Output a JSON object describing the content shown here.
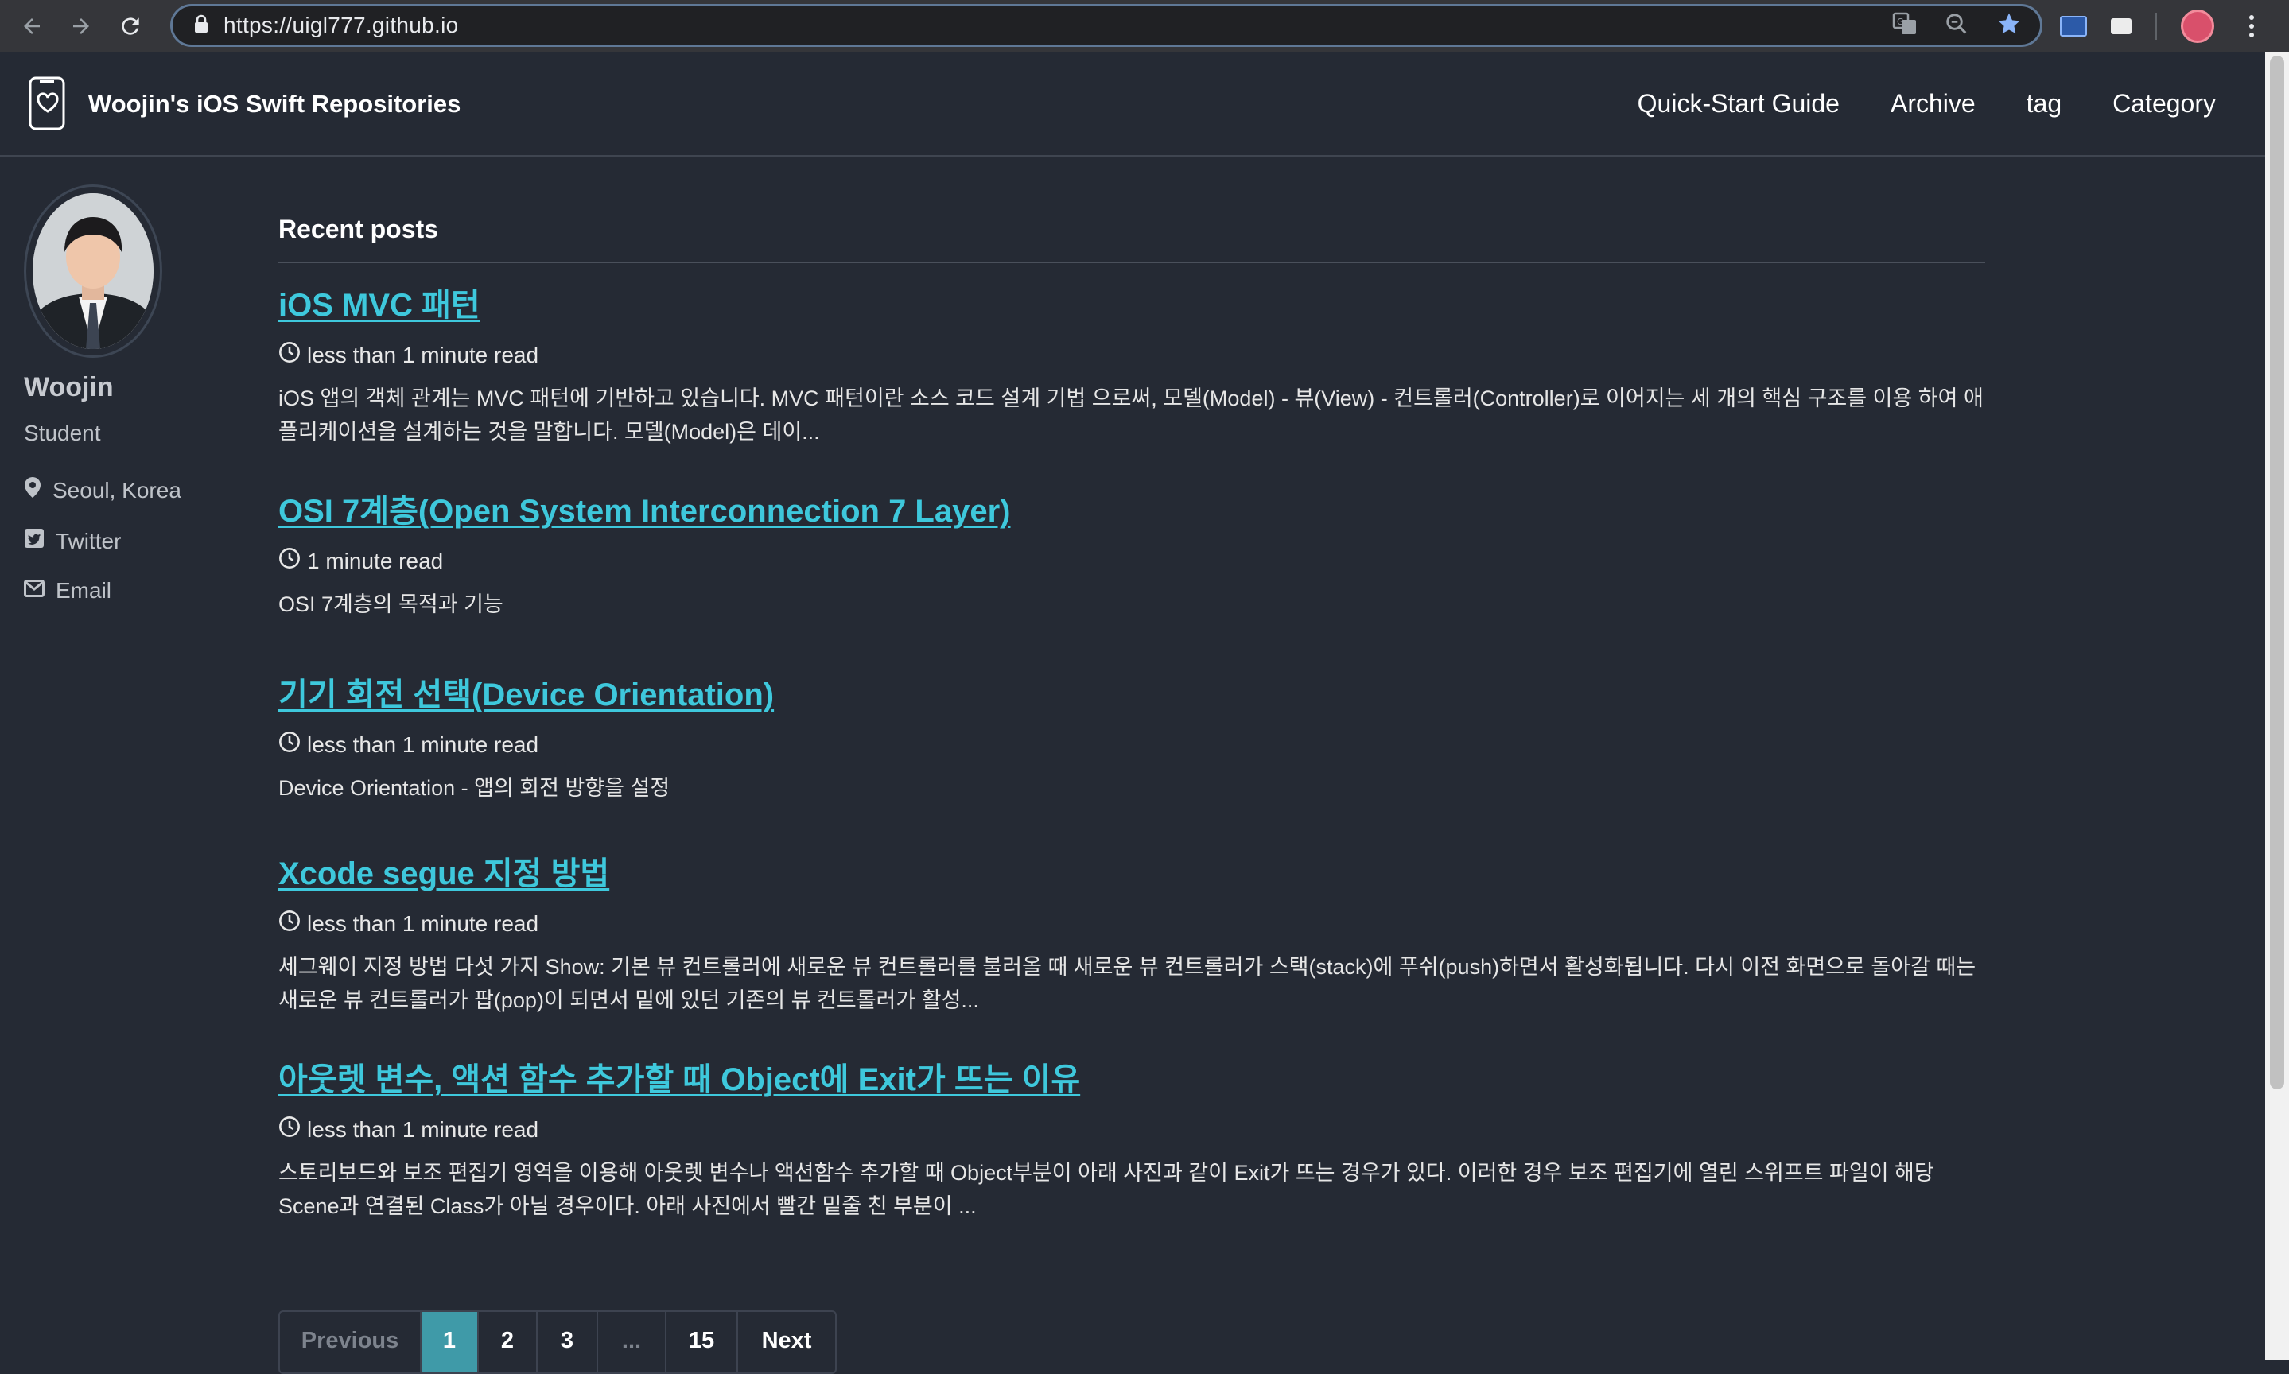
{
  "browser": {
    "url": "https://uigl777.github.io",
    "icons": [
      "back-icon",
      "forward-icon",
      "reload-icon",
      "lock-icon",
      "translate-icon",
      "zoom-icon",
      "bookmark-star-icon",
      "extension-icon",
      "extension-icon",
      "profile-icon",
      "menu-icon"
    ]
  },
  "site": {
    "title": "Woojin's iOS Swift Repositories",
    "nav": [
      "Quick-Start Guide",
      "Archive",
      "tag",
      "Category"
    ]
  },
  "author": {
    "name": "Woojin",
    "bio": "Student",
    "links": [
      {
        "label": "Seoul, Korea",
        "icon": "location-pin-icon"
      },
      {
        "label": "Twitter",
        "icon": "twitter-icon"
      },
      {
        "label": "Email",
        "icon": "email-icon"
      }
    ]
  },
  "main": {
    "section_title": "Recent posts",
    "posts": [
      {
        "title": "iOS MVC 패턴",
        "read_time": "less than 1 minute read",
        "excerpt": "iOS 앱의 객체 관계는 MVC 패턴에 기반하고 있습니다. MVC 패턴이란 소스 코드 설계 기법 으로써, 모델(Model) - 뷰(View) - 컨트롤러(Controller)로 이어지는 세 개의 핵심 구조를 이용 하여 애플리케이션을 설계하는 것을 말합니다. 모델(Model)은 데이..."
      },
      {
        "title": "OSI 7계층(Open System Interconnection 7 Layer)",
        "read_time": "1 minute read",
        "excerpt": "OSI 7계층의 목적과 기능"
      },
      {
        "title": "기기 회전 선택(Device Orientation)",
        "read_time": "less than 1 minute read",
        "excerpt": "Device Orientation - 앱의 회전 방향을 설정"
      },
      {
        "title": "Xcode segue 지정 방법",
        "read_time": "less than 1 minute read",
        "excerpt": "세그웨이 지정 방법 다섯 가지 Show: 기본 뷰 컨트롤러에 새로운 뷰 컨트롤러를 불러올 때 새로운 뷰 컨트롤러가 스택(stack)에 푸쉬(push)하면서 활성화됩니다. 다시 이전 화면으로 돌아갈 때는 새로운 뷰 컨트롤러가 팝(pop)이 되면서 밑에 있던 기존의 뷰 컨트롤러가 활성..."
      },
      {
        "title": "아웃렛 변수, 액션 함수 추가할 때 Object에 Exit가 뜨는 이유",
        "read_time": "less than 1 minute read",
        "excerpt": "스토리보드와 보조 편집기 영역을 이용해 아웃렛 변수나 액션함수 추가할 때 Object부분이 아래 사진과 같이 Exit가 뜨는 경우가 있다. 이러한 경우 보조 편집기에 열린 스위프트 파일이 해당 Scene과 연결된 Class가 아닐 경우이다. 아래 사진에서 빨간 밑줄 친 부분이 ..."
      }
    ]
  },
  "pagination": {
    "previous": "Previous",
    "pages": [
      "1",
      "2",
      "3",
      "...",
      "15"
    ],
    "current": "1",
    "next": "Next"
  },
  "colors": {
    "background": "#252a34",
    "link": "#3ec8dc",
    "current_page": "#3f9aa8"
  }
}
